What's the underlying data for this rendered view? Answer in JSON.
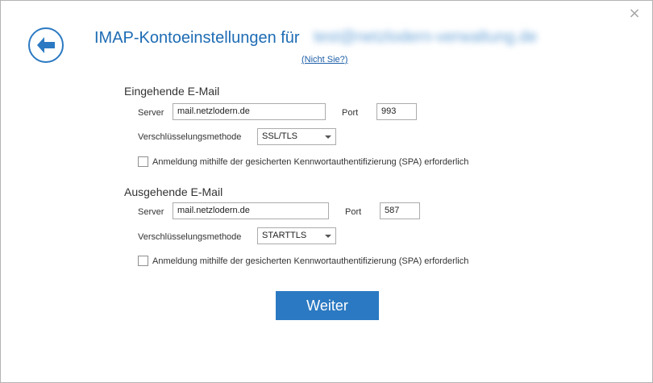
{
  "dialog": {
    "title": "IMAP-Kontoeinstellungen für",
    "account_email": "test@netzlodern-verwaltung.de",
    "not_you_link": "(Nicht Sie?)",
    "close_glyph": "×",
    "back_icon": "back-arrow-icon"
  },
  "incoming": {
    "heading": "Eingehende E-Mail",
    "server_label": "Server",
    "server_value": "mail.netzlodern.de",
    "port_label": "Port",
    "port_value": "993",
    "encryption_label": "Verschlüsselungsmethode",
    "encryption_value": "SSL/TLS",
    "spa_checked": false,
    "spa_label": "Anmeldung mithilfe der gesicherten Kennwortauthentifizierung (SPA) erforderlich"
  },
  "outgoing": {
    "heading": "Ausgehende E-Mail",
    "server_label": "Server",
    "server_value": "mail.netzlodern.de",
    "port_label": "Port",
    "port_value": "587",
    "encryption_label": "Verschlüsselungsmethode",
    "encryption_value": "STARTTLS",
    "spa_checked": false,
    "spa_label": "Anmeldung mithilfe der gesicherten Kennwortauthentifizierung (SPA) erforderlich"
  },
  "actions": {
    "next_label": "Weiter"
  },
  "colors": {
    "accent": "#2b79c2",
    "title": "#1e6cb4"
  }
}
